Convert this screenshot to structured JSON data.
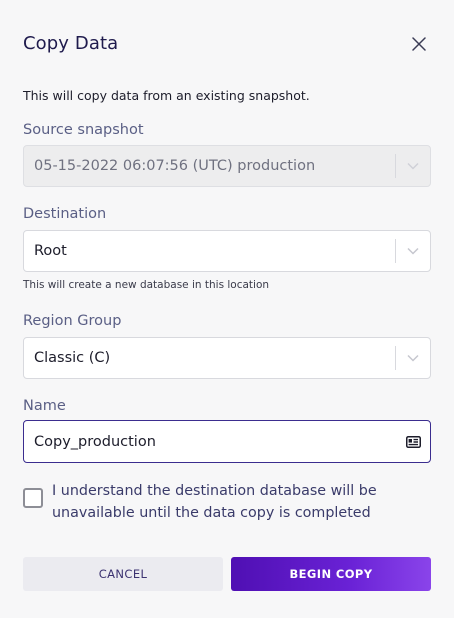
{
  "dialog": {
    "title": "Copy Data",
    "description": "This will copy data from an existing snapshot."
  },
  "source": {
    "label": "Source snapshot",
    "value": "05-15-2022 06:07:56 (UTC) production"
  },
  "destination": {
    "label": "Destination",
    "value": "Root",
    "hint": "This will create a new database in this location"
  },
  "region": {
    "label": "Region Group",
    "value": "Classic (C)"
  },
  "name": {
    "label": "Name",
    "value": "Copy_production"
  },
  "confirm": {
    "label": "I understand the destination database will be unavailable until the data copy is completed",
    "checked": false
  },
  "buttons": {
    "cancel": "CANCEL",
    "begin": "BEGIN COPY"
  },
  "colors": {
    "accent": "#5a14c8",
    "title": "#1f1b4d",
    "label": "#5a5f85"
  },
  "icons": {
    "close": "close-icon",
    "chevron": "chevron-down-icon",
    "card": "contact-card-icon"
  }
}
